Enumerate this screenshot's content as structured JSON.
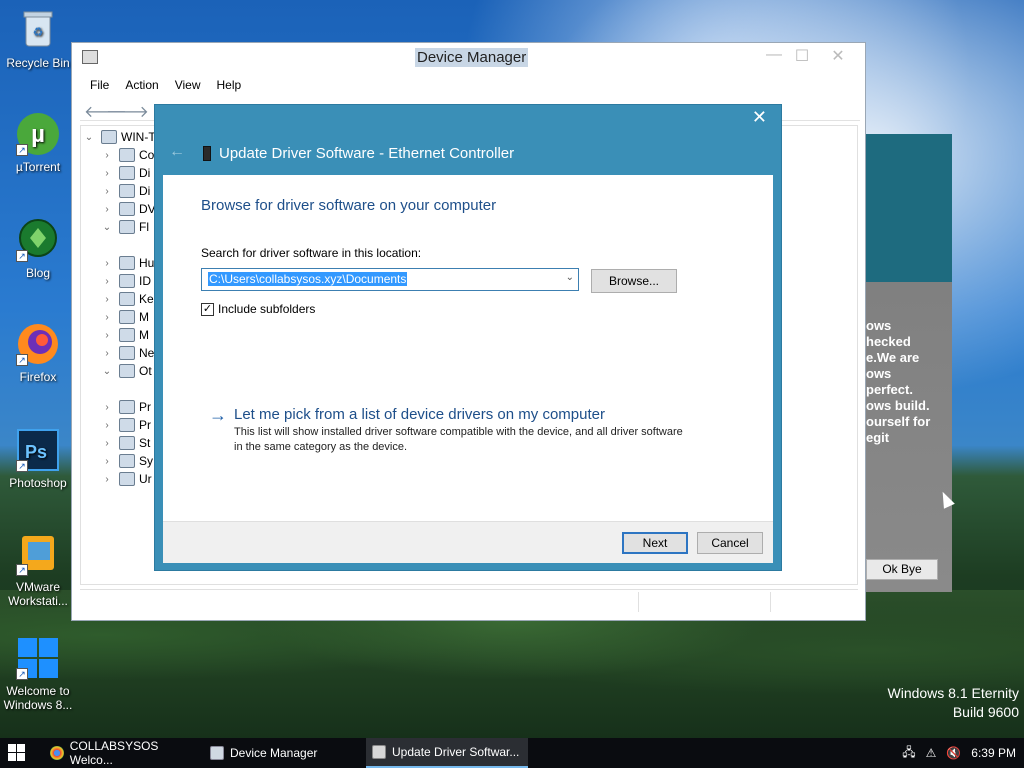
{
  "desktop": {
    "icons": [
      {
        "label": "Recycle Bin",
        "icon": "recycle-bin-icon"
      },
      {
        "label": "µTorrent",
        "icon": "utorrent-icon"
      },
      {
        "label": "Blog",
        "icon": "blog-icon"
      },
      {
        "label": "Firefox",
        "icon": "firefox-icon"
      },
      {
        "label": "Photoshop",
        "icon": "photoshop-icon"
      },
      {
        "label": "VMware Workstati...",
        "icon": "vmware-icon"
      },
      {
        "label": "Welcome to Windows 8...",
        "icon": "windows-icon"
      }
    ],
    "watermark_line1": "Windows 8.1 Eternity",
    "watermark_line2": "Build 9600"
  },
  "device_manager": {
    "title": "Device Manager",
    "menu": [
      "File",
      "Action",
      "View",
      "Help"
    ],
    "tree_root": "WIN-T",
    "tree_items": [
      "Co",
      "Di",
      "Di",
      "DV",
      "Fl",
      "",
      "Hu",
      "ID",
      "Ke",
      "M",
      "M",
      "Ne",
      "Ot",
      "",
      "Pr",
      "Pr",
      "St",
      "Sy",
      "Ur"
    ]
  },
  "popup": {
    "text": "ows\nhecked\ne.We are\nows\nperfect.\nows build.\nourself for\negit",
    "button": "Ok Bye",
    "colors": {
      "top": "#1e6b7f",
      "body": "#7b7b7b"
    }
  },
  "dialog": {
    "title": "Update Driver Software - Ethernet Controller",
    "heading": "Browse for driver software on your computer",
    "search_label": "Search for driver software in this location:",
    "path_value": "C:\\Users\\collabsysos.xyz\\Documents",
    "browse_button": "Browse...",
    "include_subfolders_label": "Include subfolders",
    "include_subfolders_checked": true,
    "pick_title": "Let me pick from a list of device drivers on my computer",
    "pick_desc": "This list will show installed driver software compatible with the device, and all driver software in the same category as the device.",
    "next_button": "Next",
    "cancel_button": "Cancel",
    "colors": {
      "frame": "#3a8fb7",
      "heading": "#1e4f8a"
    }
  },
  "taskbar": {
    "items": [
      {
        "label": "COLLABSYSOS Welco...",
        "icon": "chrome-icon"
      },
      {
        "label": "Device Manager",
        "icon": "device-manager-icon"
      },
      {
        "label": "Update Driver Softwar...",
        "icon": "driver-icon",
        "active": true
      }
    ],
    "time": "6:39 PM"
  }
}
